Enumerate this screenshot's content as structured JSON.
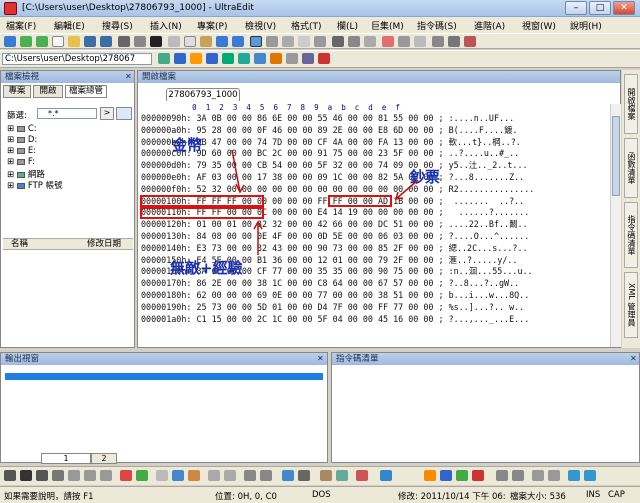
{
  "window": {
    "title": "[C:\\Users\\user\\Desktop\\27806793_1000] - UltraEdit",
    "min": "–",
    "max": "□",
    "close": "✕"
  },
  "menu": [
    "檔案(F)",
    "編輯(E)",
    "搜尋(S)",
    "插入(N)",
    "專案(P)",
    "檢視(V)",
    "格式(T)",
    "欄(L)",
    "巨集(M)",
    "指令碼(S)",
    "進階(A)",
    "視窗(W)",
    "說明(H)"
  ],
  "path_box": "C:\\Users\\user\\Desktop\\278067",
  "file_panel": {
    "title": "檔案檢視",
    "close": "✕",
    "tabs": [
      "專案",
      "開啟",
      "檔案總管"
    ],
    "filter_label": "篩選:",
    "filter_value": "*.*",
    "tree": [
      "C:",
      "D:",
      "E:",
      "F:",
      "網路",
      "FTP 帳號"
    ],
    "columns": [
      "名稱",
      "修改日期"
    ]
  },
  "editor": {
    "panel_title": "開啟檔案",
    "tab": "27806793_1000",
    "ruler": "            0  1  2  3  4  5  6  7  8  9  a  b  c  d  e  f",
    "lines": [
      "00000090h: 3A 0B 00 00 86 6E 00 00 55 46 00 00 81 55 00 00 ; :....n..UF...",
      "000000a0h: 95 28 00 00 0F 46 00 00 89 2E 00 00 E8 6D 00 00 ; B(....F....鍍.",
      "000000b0h: 9B 47 00 00 74 7D 00 00 CF 4A 00 00 FA 13 00 00 ; 軟...t}..棡..?.",
      "000000c0h: 9D 60 00 00 BC 2C 00 00 91 75 00 00 23 5F 00 00 ; ..?....u..#_..",
      "000000d0h: 79 35 00 00 CB 54 00 00 5F 32 00 00 74 09 00 00 ; y5..汢.._2..t...",
      "000000e0h: AF 03 00 00 17 38 00 00 09 1C 00 00 82 5A 00 00 ; ?...8.......Z..",
      "000000f0h: 52 32 00 00 00 00 00 00 00 00 00 00 00 00 00 00 ; R2...............",
      "00000100h: FF FF FF 00 00 00 00 00 FF FF 00 00 AD 1B 00 00 ;  .......  ..?..",
      "00000110h: FF FF 00 00 0C 00 00 00 E4 14 19 00 00 00 00 00 ;   ......?.......",
      "00000120h: 01 00 01 00 32 32 00 00 42 66 00 00 DC 51 00 00 ; ....22..Bf..鬫..",
      "00000130h: 84 08 00 00 0E 4F 00 00 0D 5E 00 00 06 03 00 00 ; ?....O...^......",
      "00000140h: E3 73 00 00 32 43 00 00 90 73 00 00 85 2F 00 00 ; 緦..2C...s...?..",
      "00000150h: E4 5E 00 00 B1 36 00 00 12 01 00 00 79 2F 00 00 ; 滙..?.....y/..",
      "00000160h: 3A 6E 00 00 CF 77 00 00 35 35 00 00 90 75 00 00 ; :n..洄...55...u..",
      "00000170h: 86 2E 00 00 38 1C 00 00 C8 64 00 00 67 57 00 00 ; ?..8...?..gW..",
      "00000180h: 62 00 00 00 69 0E 00 00 77 00 00 00 38 51 00 00 ; b...i...w...8Q..",
      "00000190h: 25 73 00 00 5D 01 00 00 D4 7F 00 00 FF 77 00 00 ; %s..]...?.. w..",
      "000001a0h: C1 15 00 00 2C 1C 00 00 5F 04 00 00 45 16 00 00 ; ?...,..._...E..."
    ]
  },
  "annotations": {
    "amount": "金幣",
    "ticket": "鈔票",
    "xp": "無敵+經驗"
  },
  "right_tabs": [
    "開啟檔案",
    "函數清單",
    "指令碼清單",
    "XML 管理員"
  ],
  "output_panel": {
    "title": "輸出視窗",
    "close": "✕",
    "tabs": [
      "1",
      "2"
    ]
  },
  "script_panel": {
    "title": "指令碼清單",
    "close": "✕"
  },
  "status": {
    "help": "如果需要說明，請按 F1",
    "position": "位置: 0H, 0, C0",
    "format": "DOS",
    "modified": "修改: 2011/10/14 下午 06:",
    "size": "檔案大小: 536",
    "ins": "INS",
    "cap": "CAP"
  },
  "colors": {
    "annotation_box": "#e01010",
    "annotation_text": "#1a2fb0",
    "selection_bar": "#1f7fe0"
  }
}
